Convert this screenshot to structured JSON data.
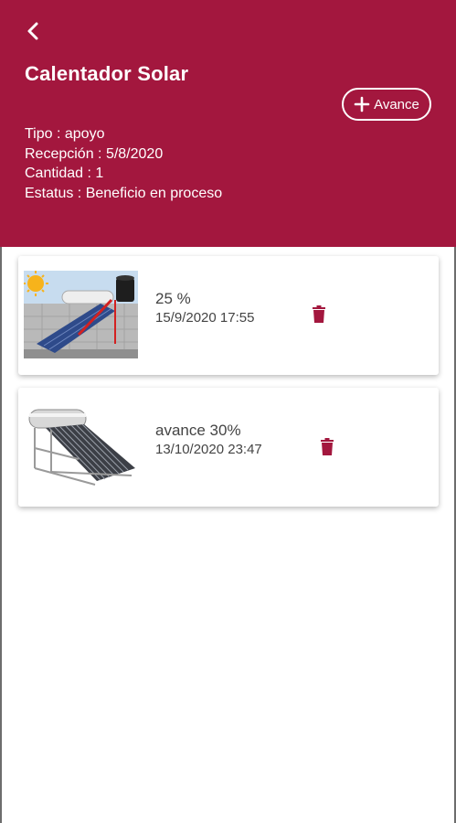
{
  "header": {
    "title": "Calentador Solar",
    "add_button_label": "Avance",
    "info": [
      "Tipo : apoyo",
      "Recepción : 5/8/2020",
      "Cantidad : 1",
      "Estatus : Beneficio en proceso"
    ]
  },
  "entries": [
    {
      "title": "25 %",
      "date": "15/9/2020 17:55",
      "image": "solar-heater-rooftop-photo"
    },
    {
      "title": "avance 30%",
      "date": "13/10/2020 23:47",
      "image": "solar-heater-product-photo"
    }
  ],
  "colors": {
    "primary": "#a3173e",
    "text": "#444444",
    "background": "#ffffff"
  },
  "icons": {
    "back": "chevron-left-icon",
    "add": "plus-icon",
    "delete": "trash-icon"
  }
}
